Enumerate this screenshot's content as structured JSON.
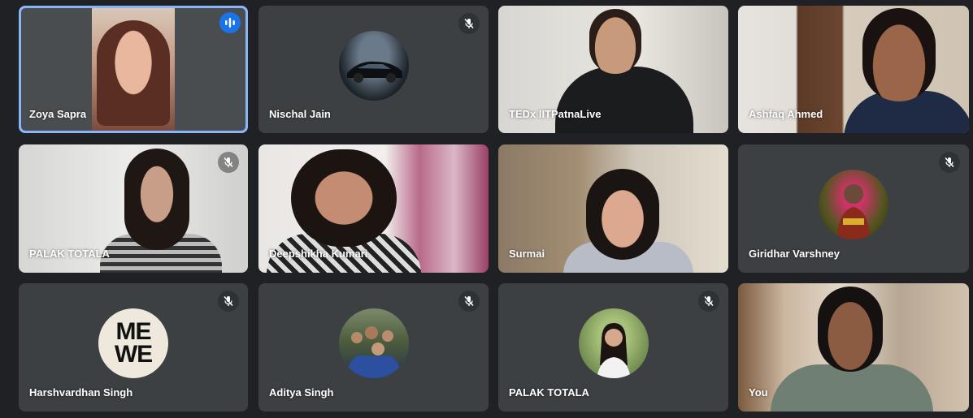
{
  "participants": [
    {
      "name": "Zoya Sapra",
      "mic": "speaking",
      "video": "on",
      "active": true
    },
    {
      "name": "Nischal Jain",
      "mic": "muted",
      "video": "off",
      "avatar": "car-photo"
    },
    {
      "name": "TEDx IITPatnaLive",
      "mic": "on",
      "video": "on"
    },
    {
      "name": "Ashfaq Ahmed",
      "mic": "on",
      "video": "on"
    },
    {
      "name": "PALAK TOTALA",
      "mic": "muted",
      "video": "on"
    },
    {
      "name": "Deepshikha Kumari",
      "mic": "on",
      "video": "on"
    },
    {
      "name": "Surmai",
      "mic": "on",
      "video": "on"
    },
    {
      "name": "Giridhar Varshney",
      "mic": "muted",
      "video": "off",
      "avatar": "person-photo"
    },
    {
      "name": "Harshvardhan Singh",
      "mic": "muted",
      "video": "off",
      "avatar": "me-we-logo",
      "avatar_text": [
        "ME",
        "WE"
      ]
    },
    {
      "name": "Aditya Singh",
      "mic": "muted",
      "video": "off",
      "avatar": "group-photo"
    },
    {
      "name": "PALAK TOTALA",
      "mic": "muted",
      "video": "off",
      "avatar": "person-photo"
    },
    {
      "name": "You",
      "mic": "on",
      "video": "on"
    }
  ],
  "colors": {
    "background": "#202124",
    "tile": "#3c4043",
    "active_border": "#8ab4f8",
    "speaking_badge": "#1a73e8"
  }
}
